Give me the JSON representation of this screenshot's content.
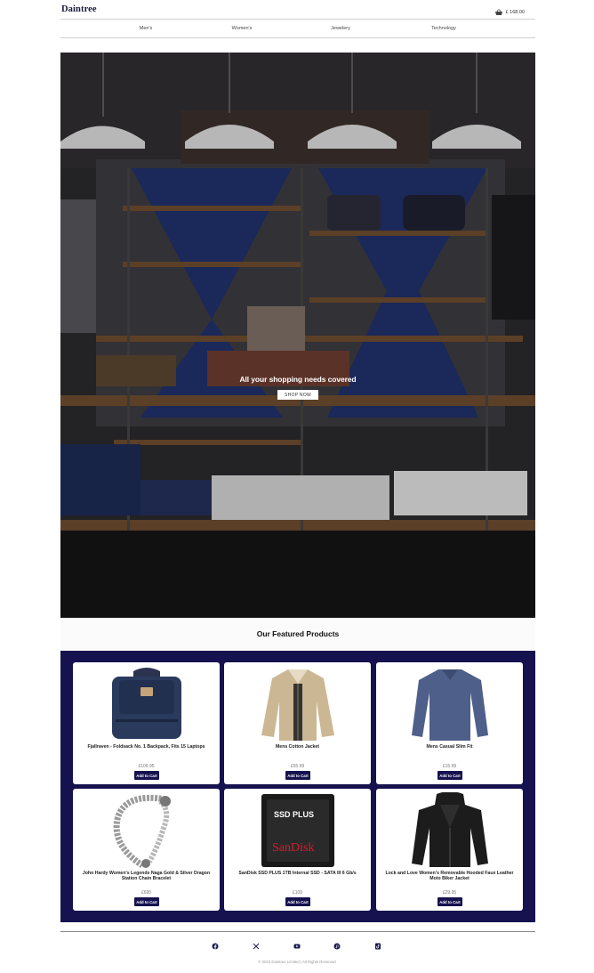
{
  "header": {
    "logo": "Daintree",
    "cart_total": "£ 168.00"
  },
  "nav": {
    "items": [
      {
        "label": "Men's"
      },
      {
        "label": "Women's"
      },
      {
        "label": "Jewelery"
      },
      {
        "label": "Technology"
      }
    ]
  },
  "hero": {
    "title": "All your shopping needs covered",
    "button_label": "SHOP NOW"
  },
  "featured": {
    "title": "Our Featured Products",
    "add_label": "Add to Cart",
    "products": [
      {
        "name": "Fjallraven - Foldsack No. 1 Backpack, Fits 15 Laptops",
        "price": "£109.95",
        "icon": "backpack-icon"
      },
      {
        "name": "Mens Cotton Jacket",
        "price": "£55.99",
        "icon": "jacket-icon"
      },
      {
        "name": "Mens Casual Slim Fit",
        "price": "£15.99",
        "icon": "shirt-icon"
      },
      {
        "name": "John Hardy Women's Legends Naga Gold & Silver Dragon Station Chain Bracelet",
        "price": "£695",
        "icon": "bracelet-icon"
      },
      {
        "name": "SanDisk SSD PLUS 1TB Internal SSD - SATA III 6 Gb/s",
        "price": "£109",
        "icon": "ssd-icon"
      },
      {
        "name": "Lock and Love Women's Removable Hooded Faux Leather Moto Biker Jacket",
        "price": "£29.95",
        "icon": "leather-jacket-icon"
      }
    ],
    "ssd_brand": "SanDisk",
    "ssd_model": "SSD PLUS"
  },
  "footer": {
    "social": [
      {
        "icon": "facebook-icon"
      },
      {
        "icon": "x-icon"
      },
      {
        "icon": "youtube-icon"
      },
      {
        "icon": "pinterest-icon"
      },
      {
        "icon": "tiktok-icon"
      }
    ],
    "copyright": "© 2023 Daintree Limited | All Rights Reserved"
  },
  "colors": {
    "brand_navy": "#16124f",
    "logo": "#1a1a3e"
  }
}
